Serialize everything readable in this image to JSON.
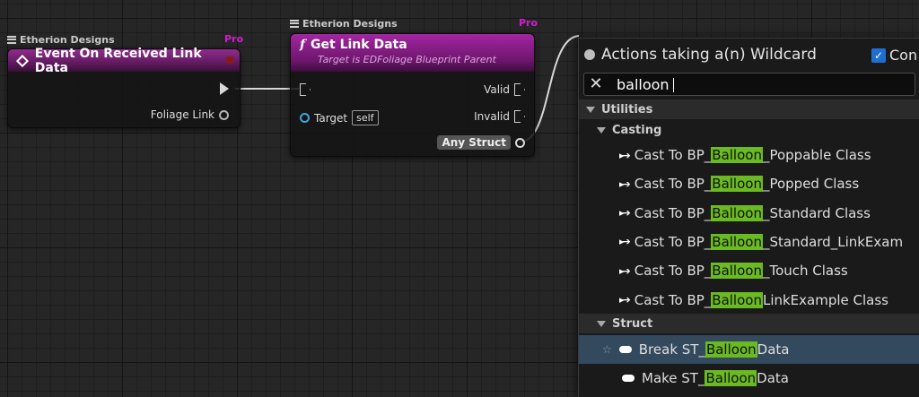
{
  "graph": {
    "event_node": {
      "category": "Etherion Designs",
      "pro_badge": "Pro",
      "title": "Event On Received Link Data",
      "output_pin": "Foliage Link"
    },
    "function_node": {
      "category": "Etherion Designs",
      "pro_badge": "Pro",
      "icon": "f",
      "title": "Get Link Data",
      "subtitle": "Target is EDFoliage Blueprint Parent",
      "input_pin": "Target",
      "input_default": "self",
      "valid_pin": "Valid",
      "invalid_pin": "Invalid",
      "struct_pin": "Any Struct"
    }
  },
  "menu": {
    "title": "Actions taking a(n) Wildcard",
    "context_checkbox_label": "Con",
    "search_value": "balloon",
    "utilities_header": "Utilities",
    "casting_header": "Casting",
    "struct_header": "Struct",
    "highlight": "Balloon",
    "casting_items": [
      {
        "pre": "Cast To BP_",
        "post": "_Poppable Class"
      },
      {
        "pre": "Cast To BP_",
        "post": "_Popped Class"
      },
      {
        "pre": "Cast To BP_",
        "post": "_Standard Class"
      },
      {
        "pre": "Cast To BP_",
        "post": "_Standard_LinkExam"
      },
      {
        "pre": "Cast To BP_",
        "post": "_Touch Class"
      },
      {
        "pre": "Cast To BP_",
        "post": "LinkExample Class"
      }
    ],
    "struct_items": [
      {
        "pre": "Break ST_",
        "post": "Data"
      },
      {
        "pre": "Make ST_",
        "post": "Data"
      }
    ]
  },
  "colors": {
    "function_header": "#a326a2",
    "search_highlight": "#6aba21",
    "selected_row": "#334a5e",
    "pro_badge": "#d31dd0",
    "checkbox": "#1f6fd1"
  }
}
